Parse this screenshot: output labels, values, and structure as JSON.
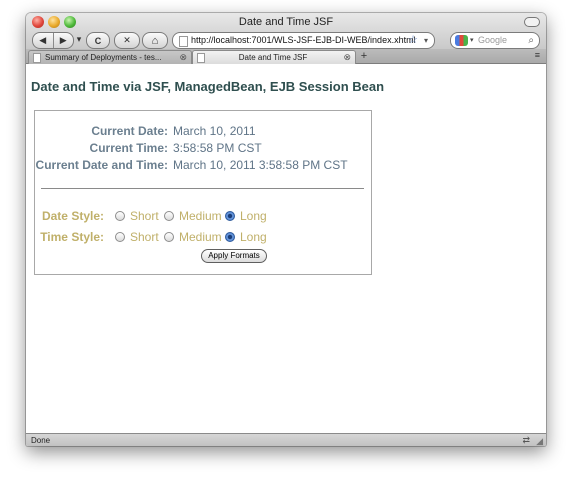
{
  "window": {
    "title": "Date and Time JSF",
    "nav": {
      "back": "◀",
      "forward": "▶",
      "menu": "▾",
      "reload": "C",
      "stop": "✕",
      "home": "⌂"
    },
    "url": "http://localhost:7001/WLS-JSF-EJB-DI-WEB/index.xhtml",
    "search_placeholder": "Google",
    "tabs": [
      {
        "label": "Summary of Deployments - tes...",
        "active": false
      },
      {
        "label": "Date and Time JSF",
        "active": true
      }
    ],
    "new_tab": "+",
    "status": "Done"
  },
  "page": {
    "heading": "Date and Time via JSF, ManagedBean, EJB Session Bean",
    "current_date": {
      "label": "Current Date:",
      "value": "March 10, 2011"
    },
    "current_time": {
      "label": "Current Time:",
      "value": "3:58:58 PM CST"
    },
    "current_datetime": {
      "label": "Current Date and Time:",
      "value": "March 10, 2011 3:58:58 PM CST"
    },
    "date_style": {
      "label": "Date Style:",
      "options": [
        "Short",
        "Medium",
        "Long"
      ],
      "selected": "Long"
    },
    "time_style": {
      "label": "Time Style:",
      "options": [
        "Short",
        "Medium",
        "Long"
      ],
      "selected": "Long"
    },
    "apply_button": "Apply Formats"
  },
  "colors": {
    "heading": "#2f4f4f",
    "info_text": "#5f7487",
    "style_text": "#c0b06a"
  }
}
